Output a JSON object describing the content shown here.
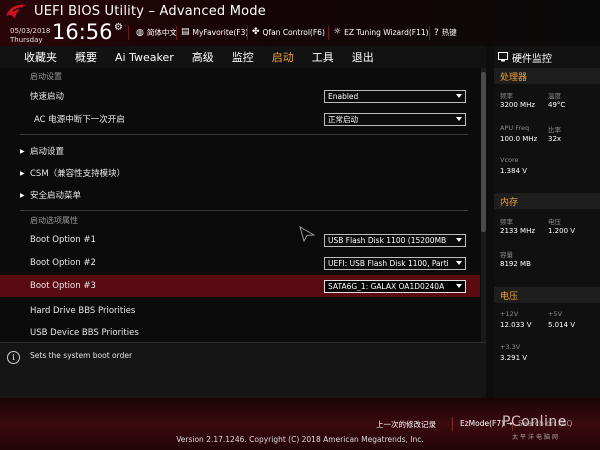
{
  "header": {
    "title": "UEFI BIOS Utility – Advanced Mode",
    "date": "05/03/2018",
    "day": "Thursday",
    "time": "16:56",
    "tools": {
      "language": "简体中文",
      "favorite": "MyFavorite(F3)",
      "qfan": "Qfan Control(F6)",
      "ez_tuning": "EZ Tuning Wizard(F11)",
      "hotkeys": "热键"
    }
  },
  "tabs": [
    {
      "label": "收藏夹",
      "active": false
    },
    {
      "label": "概要",
      "active": false
    },
    {
      "label": "Ai Tweaker",
      "active": false
    },
    {
      "label": "高级",
      "active": false
    },
    {
      "label": "监控",
      "active": false
    },
    {
      "label": "启动",
      "active": true
    },
    {
      "label": "工具",
      "active": false
    },
    {
      "label": "退出",
      "active": false
    }
  ],
  "main": {
    "boot_settings_section": "启动设置",
    "fast_boot": {
      "label": "快速启动",
      "value": "Enabled"
    },
    "ac_power": {
      "label": "AC 电源中断下一次开启",
      "value": "正常启动"
    },
    "group_boot_config": "启动设置",
    "group_csm": "CSM（兼容性支持模块）",
    "group_secure_boot": "安全启动菜单",
    "boot_priority_section": "启动选项属性",
    "boot_option_1": {
      "label": "Boot Option #1",
      "value": "USB Flash Disk 1100  (15200MB"
    },
    "boot_option_2": {
      "label": "Boot Option #2",
      "value": "UEFI: USB Flash Disk 1100, Parti"
    },
    "boot_option_3": {
      "label": "Boot Option #3",
      "value": "SATA6G_1: GALAX OA1D0240A"
    },
    "hdd_bbs": "Hard Drive BBS Priorities",
    "usb_bbs": "USB Device BBS Priorities"
  },
  "help": {
    "icon": "info-icon",
    "text": "Sets the system boot order"
  },
  "hw_monitor": {
    "title": "硬件监控",
    "cpu": {
      "title": "处理器",
      "freq_label": "频率",
      "freq_value": "3200 MHz",
      "temp_label": "温度",
      "temp_value": "49°C",
      "apu_label": "APU Freq",
      "apu_value": "100.0 MHz",
      "ratio_label": "比率",
      "ratio_value": "32x",
      "vcore_label": "Vcore",
      "vcore_value": "1.384 V"
    },
    "memory": {
      "title": "内存",
      "freq_label": "频率",
      "freq_value": "2133 MHz",
      "volt_label": "电压",
      "volt_value": "1.200 V",
      "cap_label": "容量",
      "cap_value": "8192 MB"
    },
    "voltage": {
      "title": "电压",
      "v12_label": "+12V",
      "v12_value": "12.033 V",
      "v5_label": "+5V",
      "v5_value": "5.014 V",
      "v33_label": "+3.3V",
      "v33_value": "3.291 V"
    }
  },
  "bottom": {
    "last_modified": "上一次的修改记录",
    "ez_mode": "EzMode(F7)",
    "search": "Search on FAQ",
    "version": "Version 2.17.1246. Copyright (C) 2018 American Megatrends, Inc.",
    "watermark": "PConline",
    "watermark_sub": "太平洋电脑网"
  },
  "colors": {
    "accent": "#f0a23a",
    "highlight_row": "#5a0b12",
    "brand_red": "#3a0a0e"
  }
}
